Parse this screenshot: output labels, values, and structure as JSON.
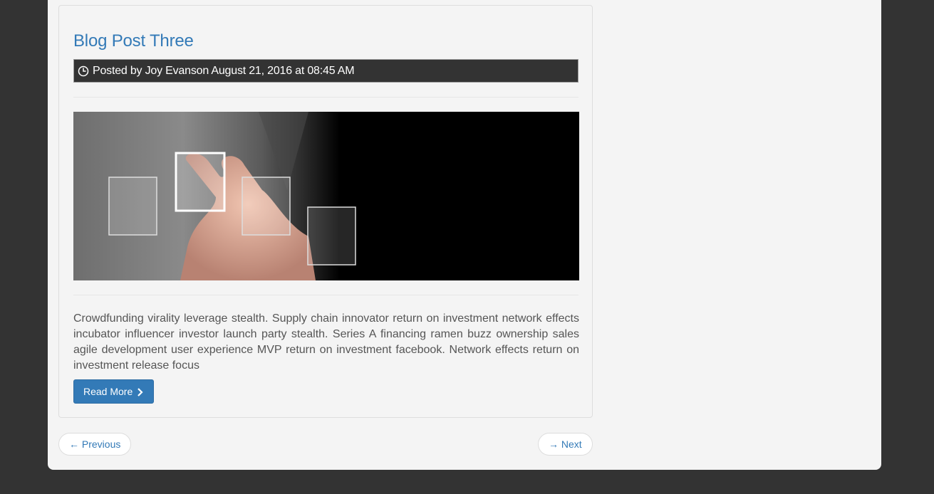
{
  "post": {
    "title": "Blog Post Three",
    "meta": "Posted by Joy Evanson August 21, 2016 at 08:45 AM",
    "meta_icon": "clock-icon",
    "image_alt": "hand-touching-virtual-squares",
    "excerpt": "Crowdfunding virality leverage stealth. Supply chain innovator return on investment network effects incubator influencer investor launch party stealth. Series A financing ramen buzz ownership sales agile development user experience MVP return on investment facebook. Network effects return on investment release focus",
    "read_more_label": "Read More",
    "read_more_icon": "chevron-right-icon"
  },
  "pager": {
    "previous_label": "← Previous",
    "next_label": "→ Next"
  },
  "colors": {
    "background": "#333333",
    "container": "#f4f4f4",
    "link": "#337ab7",
    "button": "#337ab7"
  }
}
